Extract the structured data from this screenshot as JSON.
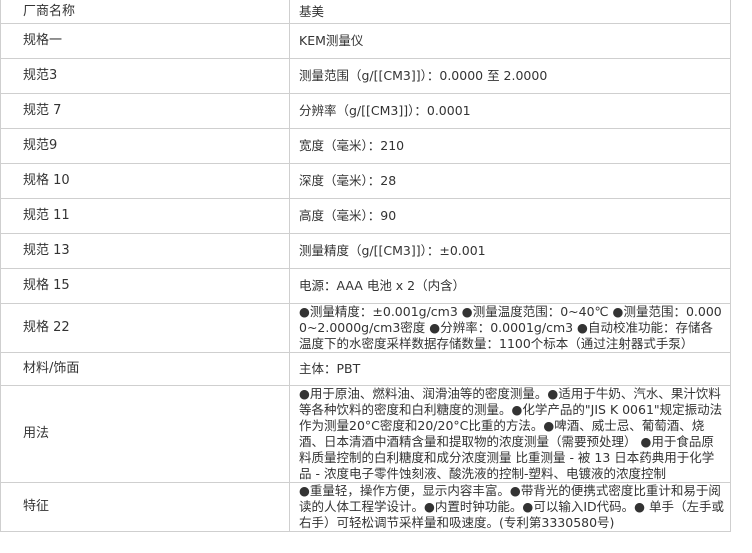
{
  "rows": [
    {
      "label": "厂商名称",
      "value": "基美"
    },
    {
      "label": "规格一",
      "value": "KEM测量仪"
    },
    {
      "label": "规范3",
      "value": "测量范围（g/[[CM3]]）：0.0000 至 2.0000"
    },
    {
      "label": "规范 7",
      "value": "分辨率（g/[[CM3]]）：0.0001"
    },
    {
      "label": "规范9",
      "value": "宽度（毫米）：210"
    },
    {
      "label": "规格 10",
      "value": "深度（毫米）：28"
    },
    {
      "label": "规范 11",
      "value": "高度（毫米）：90"
    },
    {
      "label": "规范 13",
      "value": "测量精度（g/[[CM3]]）：±0.001"
    },
    {
      "label": "规格 15",
      "value": "电源：AAA 电池 x 2（内含）"
    },
    {
      "label": "规格 22",
      "value": "●测量精度：±0.001g/cm3 ●测量温度范围：0~40℃ ●测量范围：0.0000~2.0000g/cm3密度 ●分辨率：0.0001g/cm3 ●自动校准功能：存储各温度下的水密度采样数据存储数量：1100个标本（通过注射器式手泵）"
    },
    {
      "label": "材料/饰面",
      "value": "主体：PBT"
    },
    {
      "label": "用法",
      "value": "●用于原油、燃料油、润滑油等的密度测量。●适用于牛奶、汽水、果汁饮料等各种饮料的密度和白利糖度的测量。●化学产品的\"JIS K 0061\"规定振动法作为测量20°C密度和20/20°C比重的方法。●啤酒、威士忌、葡萄酒、烧酒、日本清酒中酒精含量和提取物的浓度测量（需要预处理） ●用于食品原料质量控制的白利糖度和成分浓度测量 比重测量 - 被 13 日本药典用于化学品 - 浓度电子零件蚀刻液、酸洗液的控制-塑料、电镀液的浓度控制"
    },
    {
      "label": "特征",
      "value": "●重量轻，操作方便，显示内容丰富。●带背光的便携式密度比重计和易于阅读的人体工程学设计。●内置时钟功能。●可以输入ID代码。● 单手（左手或右手）可轻松调节采样量和吸速度。(专利第3330580号)"
    }
  ]
}
